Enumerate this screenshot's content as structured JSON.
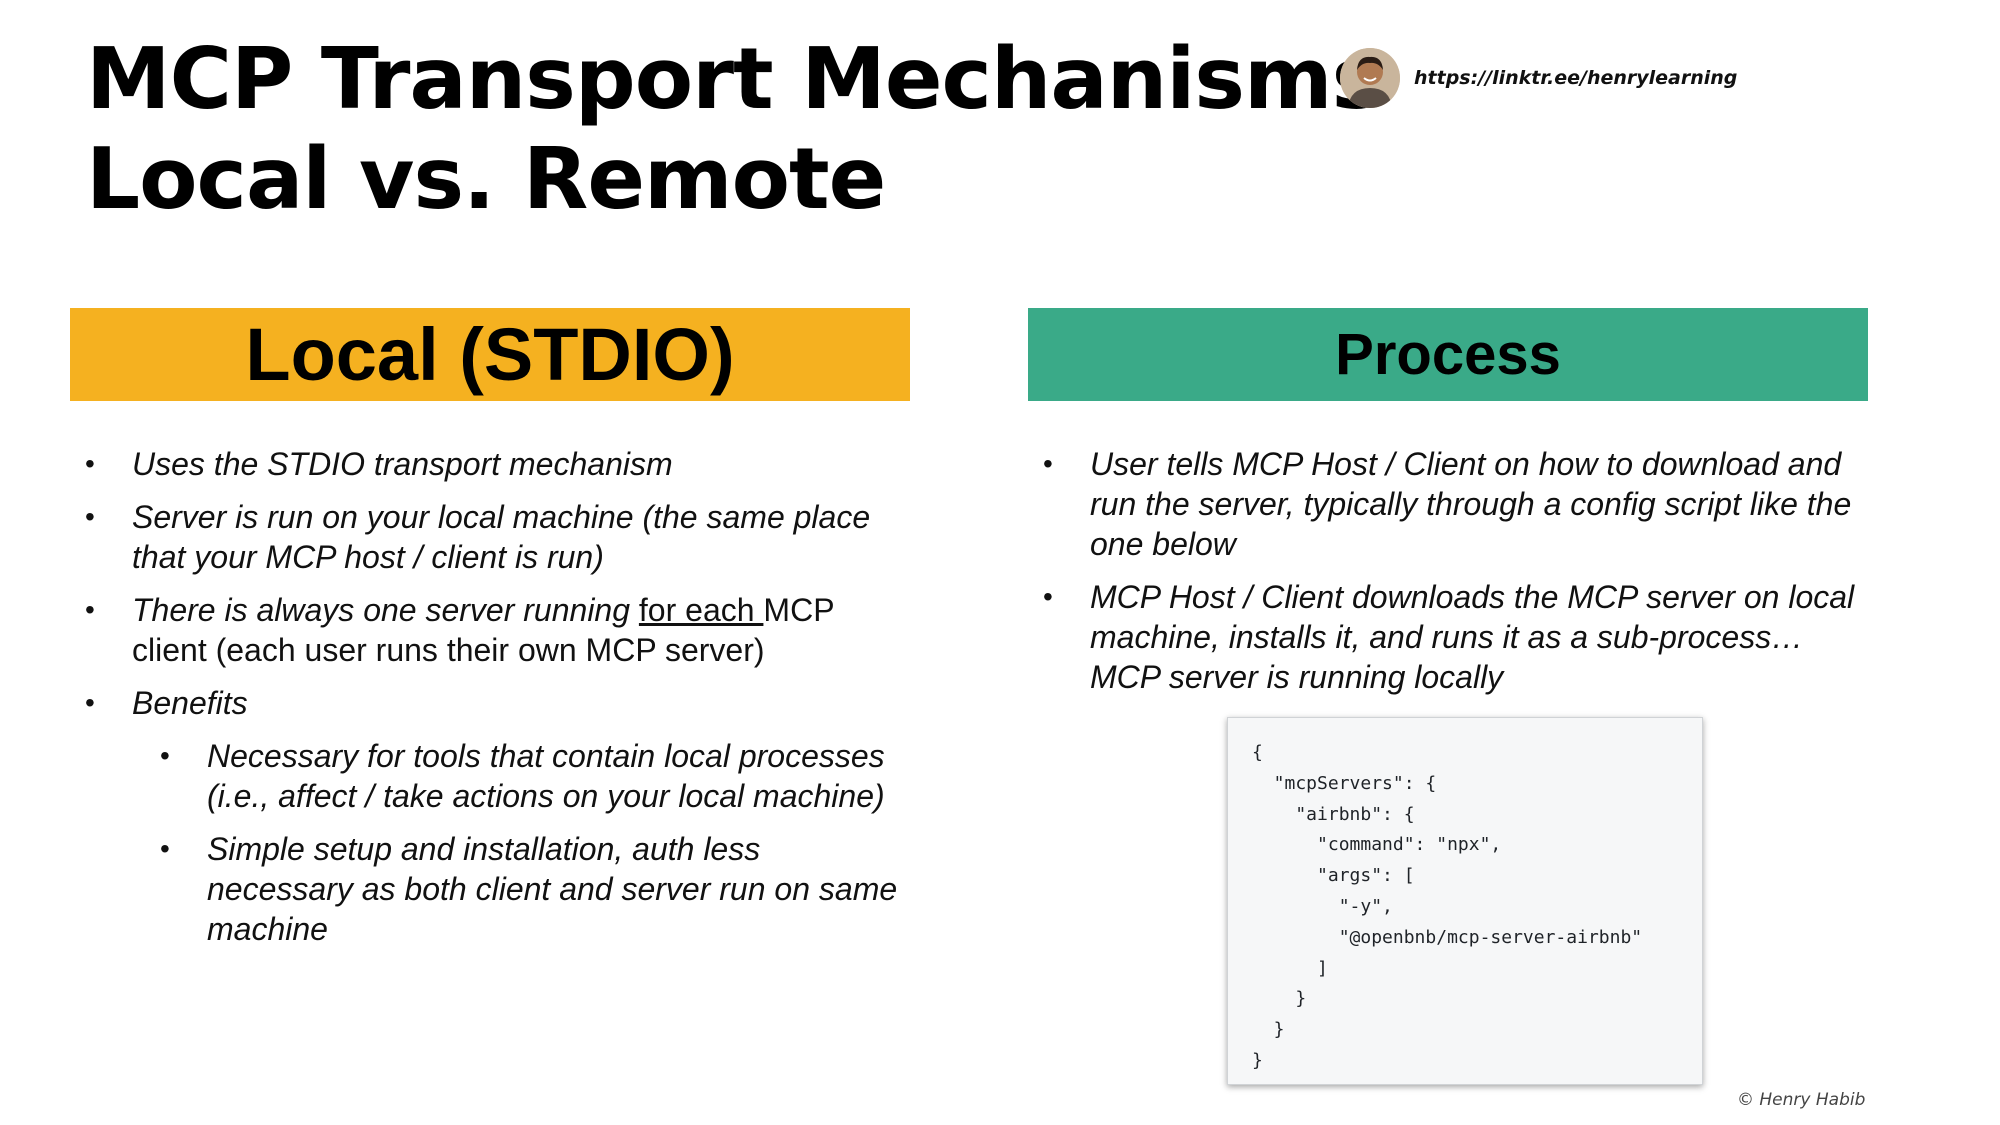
{
  "title": {
    "line1": "MCP Transport Mechanisms",
    "line2": "Local vs. Remote"
  },
  "author": {
    "link": "https://linktr.ee/henrylearning",
    "avatar_icon": "person-avatar-icon"
  },
  "left": {
    "heading": "Local (STDIO)",
    "bullets": [
      "Uses the STDIO transport mechanism",
      "Server is run on your local machine (the same place that your MCP host / client is run)",
      {
        "italic_part": "There is always one server running ",
        "underlined_part": "for each ",
        "normal_part": "MCP client (each user runs their own MCP server)"
      },
      "Benefits"
    ],
    "sub_bullets": [
      "Necessary for tools that contain local processes (i.e., affect / take actions on your local machine)",
      "Simple setup and installation, auth less necessary as both client and server run on same machine"
    ]
  },
  "right": {
    "heading": "Process",
    "bullets": [
      "User tells MCP Host / Client on how to download and run the server, typically through a config script like the one below",
      "MCP Host / Client downloads the MCP server on local machine, installs it, and runs it as a sub-process… MCP server is running locally"
    ]
  },
  "code": {
    "lines": [
      "{",
      "  \"mcpServers\": {",
      "    \"airbnb\": {",
      "      \"command\": \"npx\",",
      "      \"args\": [",
      "        \"-y\",",
      "        \"@openbnb/mcp-server-airbnb\"",
      "      ]",
      "    }",
      "  }",
      "}"
    ]
  },
  "copyright": "© Henry Habib",
  "colors": {
    "left_banner": "#f5b120",
    "right_banner": "#3aaa88"
  }
}
